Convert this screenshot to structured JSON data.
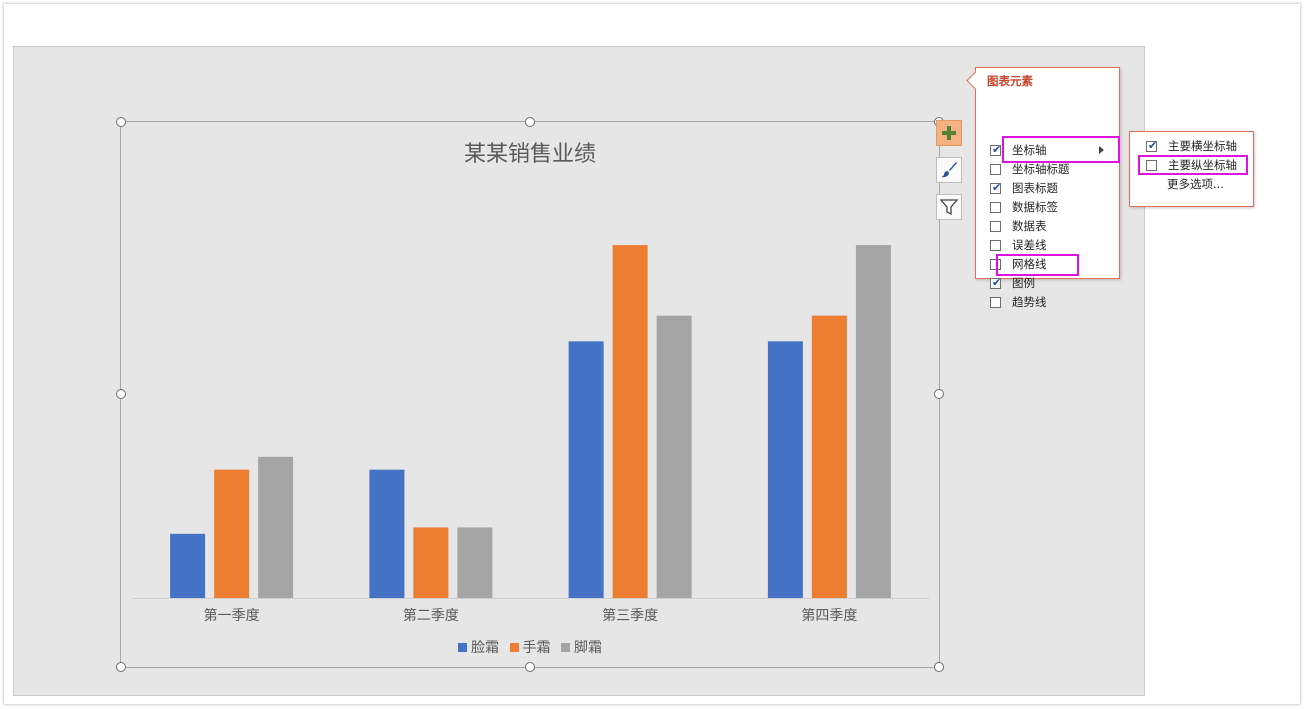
{
  "chart": {
    "title": "某某销售业绩",
    "legend": [
      {
        "label": "脸霜",
        "color": "#4472C4"
      },
      {
        "label": "手霜",
        "color": "#ED7D31"
      },
      {
        "label": "脚霜",
        "color": "#A5A5A5"
      }
    ]
  },
  "chart_data": {
    "type": "bar",
    "title": "某某销售业绩",
    "categories": [
      "第一季度",
      "第二季度",
      "第三季度",
      "第四季度"
    ],
    "series": [
      {
        "name": "脸霜",
        "color": "#4472C4",
        "values": [
          50,
          100,
          200,
          200
        ]
      },
      {
        "name": "手霜",
        "color": "#ED7D31",
        "values": [
          100,
          55,
          275,
          220
        ]
      },
      {
        "name": "脚霜",
        "color": "#A5A5A5",
        "values": [
          110,
          55,
          220,
          275
        ]
      }
    ],
    "ylim": [
      0,
      300
    ],
    "grid": false,
    "axes_shown": {
      "x": true,
      "y": false
    },
    "legend_position": "bottom"
  },
  "side_buttons": [
    {
      "icon": "plus-icon"
    },
    {
      "icon": "paintbrush-icon"
    },
    {
      "icon": "funnel-icon"
    }
  ],
  "elements_panel": {
    "title": "图表元素",
    "items": [
      {
        "label": "坐标轴",
        "checked": true,
        "submenu": true
      },
      {
        "label": "坐标轴标题",
        "checked": false
      },
      {
        "label": "图表标题",
        "checked": true
      },
      {
        "label": "数据标签",
        "checked": false
      },
      {
        "label": "数据表",
        "checked": false
      },
      {
        "label": "误差线",
        "checked": false
      },
      {
        "label": "网格线",
        "checked": false
      },
      {
        "label": "图例",
        "checked": true
      },
      {
        "label": "趋势线",
        "checked": false
      }
    ]
  },
  "axis_submenu": {
    "items": [
      {
        "label": "主要横坐标轴",
        "checked": true
      },
      {
        "label": "主要纵坐标轴",
        "checked": false
      },
      {
        "label": "更多选项..."
      }
    ]
  },
  "highlight_color": "#E012E0"
}
